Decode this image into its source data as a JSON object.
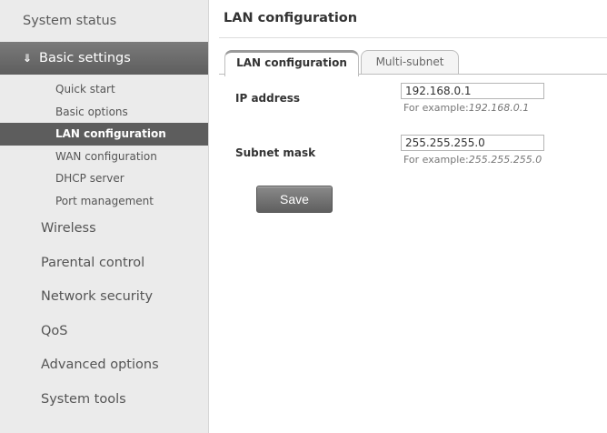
{
  "sidebar": {
    "top_item": "System status",
    "group": {
      "label": "Basic settings",
      "icon": "double-chevron-down-icon",
      "items": [
        {
          "label": "Quick start"
        },
        {
          "label": "Basic options"
        },
        {
          "label": "LAN configuration"
        },
        {
          "label": "WAN configuration"
        },
        {
          "label": "DHCP server"
        },
        {
          "label": "Port management"
        }
      ],
      "active_item": "LAN configuration"
    },
    "items": [
      {
        "label": "Wireless"
      },
      {
        "label": "Parental control"
      },
      {
        "label": "Network security"
      },
      {
        "label": "QoS"
      },
      {
        "label": "Advanced options"
      },
      {
        "label": "System tools"
      }
    ]
  },
  "main": {
    "title": "LAN configuration",
    "tabs": [
      {
        "label": "LAN configuration",
        "active": true
      },
      {
        "label": "Multi-subnet",
        "active": false
      }
    ],
    "form": {
      "ip": {
        "label": "IP address",
        "value": "192.168.0.1",
        "hint_prefix": "For example:",
        "hint_example": "192.168.0.1"
      },
      "mask": {
        "label": "Subnet mask",
        "value": "255.255.255.0",
        "hint_prefix": "For example:",
        "hint_example": "255.255.255.0"
      }
    },
    "save_label": "Save"
  }
}
